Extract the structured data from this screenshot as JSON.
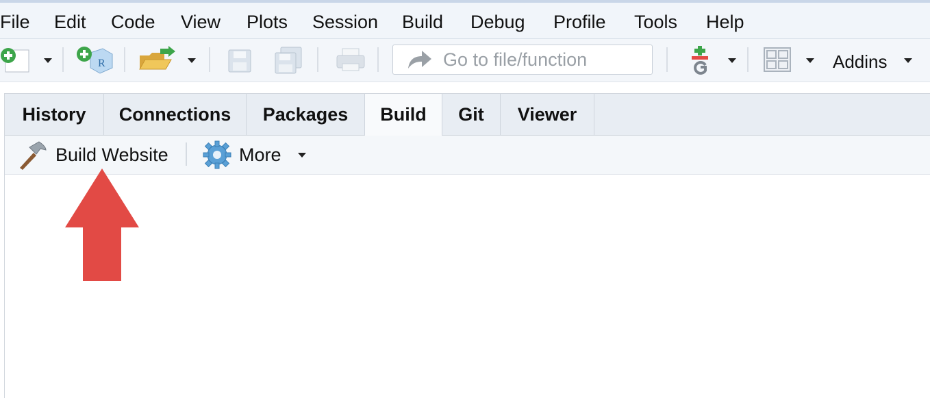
{
  "menu": [
    "File",
    "Edit",
    "Code",
    "View",
    "Plots",
    "Session",
    "Build",
    "Debug",
    "Profile",
    "Tools",
    "Help"
  ],
  "toolbar": {
    "goto_placeholder": "Go to file/function",
    "addins_label": "Addins",
    "icons": [
      "new-file-icon",
      "new-project-icon",
      "open-file-icon",
      "save-icon",
      "save-all-icon",
      "print-icon",
      "go-to-arrow-icon",
      "git-icon",
      "pane-layout-icon"
    ]
  },
  "tabs": {
    "items": [
      "History",
      "Connections",
      "Packages",
      "Build",
      "Git",
      "Viewer"
    ],
    "active": "Build"
  },
  "build_toolbar": {
    "build_website_label": "Build Website",
    "more_label": "More"
  },
  "annotation": {
    "arrow_color": "#e24a45"
  }
}
